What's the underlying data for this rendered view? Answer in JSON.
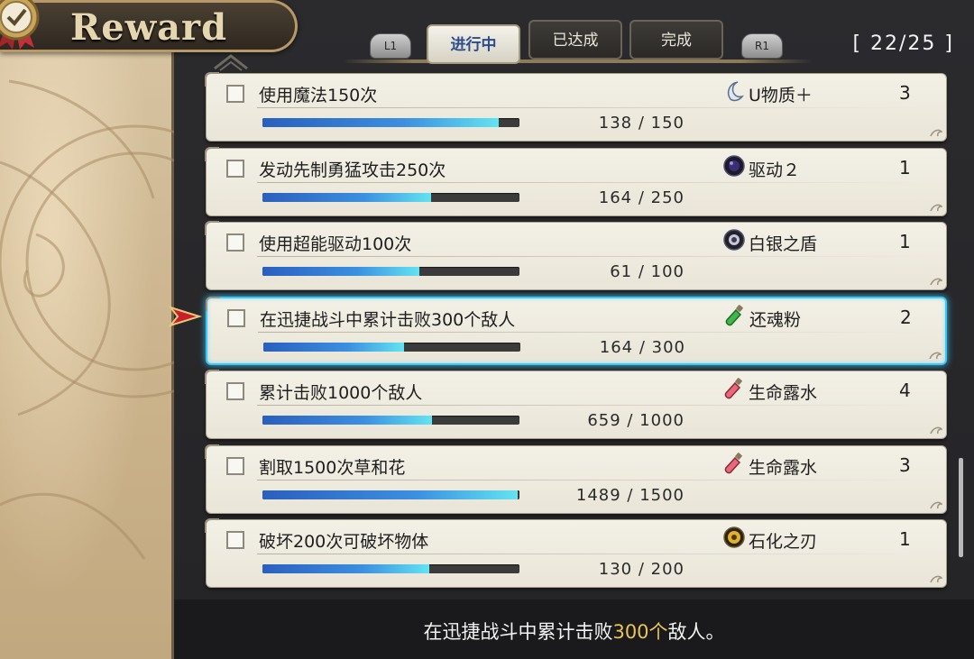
{
  "header": {
    "title": "Reward",
    "counter": "[ 22/25 ]"
  },
  "tabs": {
    "l1": "L1",
    "r1": "R1",
    "items": [
      "进行中",
      "已达成",
      "完成"
    ],
    "active_index": 0
  },
  "quests": [
    {
      "task": "使用魔法150次",
      "current": 138,
      "total": 150,
      "progress_text": "138 / 150",
      "reward": "U物质＋",
      "reward_icon": "crescent-icon",
      "qty": "3"
    },
    {
      "task": "发动先制勇猛攻击250次",
      "current": 164,
      "total": 250,
      "progress_text": "164 / 250",
      "reward": "驱动２",
      "reward_icon": "dark-orb-icon",
      "qty": "1"
    },
    {
      "task": "使用超能驱动100次",
      "current": 61,
      "total": 100,
      "progress_text": "61 / 100",
      "reward": "白银之盾",
      "reward_icon": "silver-orb-icon",
      "qty": "1"
    },
    {
      "task": "在迅捷战斗中累计击败300个敌人",
      "current": 164,
      "total": 300,
      "progress_text": "164 / 300",
      "reward": "还魂粉",
      "reward_icon": "green-bottle-icon",
      "qty": "2",
      "selected": true
    },
    {
      "task": "累计击败1000个敌人",
      "current": 659,
      "total": 1000,
      "progress_text": "659 / 1000",
      "reward": "生命露水",
      "reward_icon": "red-bottle-icon",
      "qty": "4"
    },
    {
      "task": "割取1500次草和花",
      "current": 1489,
      "total": 1500,
      "progress_text": "1489 / 1500",
      "reward": "生命露水",
      "reward_icon": "red-bottle-icon",
      "qty": "3"
    },
    {
      "task": "破坏200次可破坏物体",
      "current": 130,
      "total": 200,
      "progress_text": "130 / 200",
      "reward": "石化之刃",
      "reward_icon": "gold-orb-icon",
      "qty": "1"
    }
  ],
  "description": {
    "prefix": "在迅捷战斗中累计击败",
    "highlight": "300个",
    "suffix": "敌人。"
  },
  "colors": {
    "selection": "#3ec7f0",
    "highlight": "#e9c45a",
    "bar_start": "#2a5fbe",
    "bar_end": "#63e3f2"
  }
}
